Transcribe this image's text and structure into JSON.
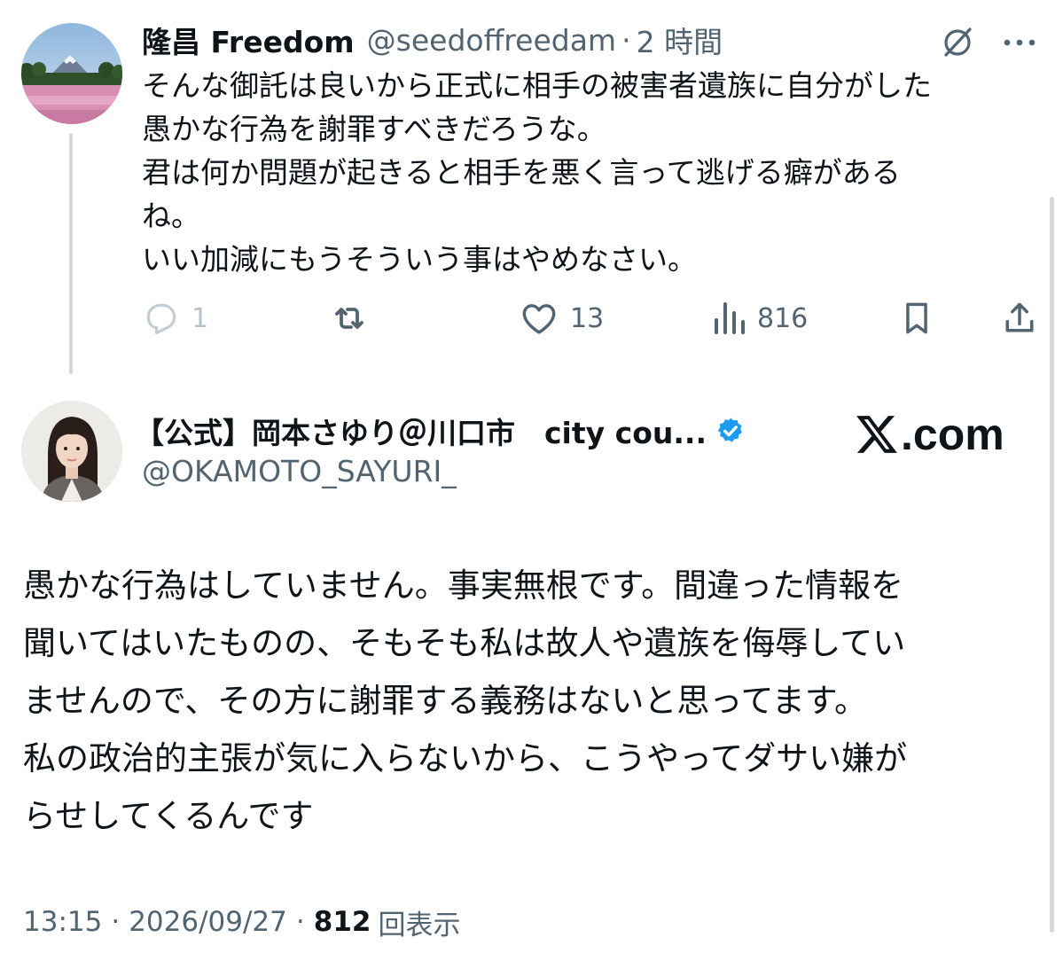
{
  "reply": {
    "author_name": "隆昌 Freedom",
    "author_handle": "@seedoffreedam",
    "dot": "·",
    "time_ago": "2 時間",
    "lines": [
      "そんな御託は良いから正式に相手の被害者遺族に自分がした",
      "愚かな行為を謝罪すべきだろうな。",
      "君は何か問題が起きると相手を悪く言って逃げる癖がある",
      "ね。",
      "いい加減にもうそういう事はやめなさい。"
    ],
    "actions": {
      "reply_count": "1",
      "like_count": "13",
      "views_count": "816"
    },
    "icons": [
      "grok-icon",
      "more-icon",
      "reply-icon",
      "retweet-icon",
      "like-icon",
      "views-icon",
      "bookmark-icon",
      "share-icon"
    ]
  },
  "main_post": {
    "author_name": "【公式】岡本さゆり＠川口市　city cou...",
    "author_handle": "@OKAMOTO_SAYURI_",
    "verified_color": "#1d9bf0",
    "watermark": "𝕏.com",
    "watermark_text": ".com",
    "lines": [
      "愚かな行為はしていません。事実無根です。間違った情報を",
      "聞いてはいたものの、そもそも私は故人や遺族を侮辱してい",
      "ませんので、その方に謝罪する義務はないと思ってます。",
      "私の政治的主張が気に入らないから、こうやってダサい嫌が",
      "らせしてくるんです"
    ],
    "meta": {
      "time": "13:15",
      "dot": "·",
      "date": "2026/09/27",
      "view_count": "812",
      "view_label": "回表示"
    }
  },
  "colors": {
    "text": "#0f1419",
    "secondary": "#536471",
    "thread_line": "#cfd9de",
    "accent": "#1d9bf0"
  }
}
